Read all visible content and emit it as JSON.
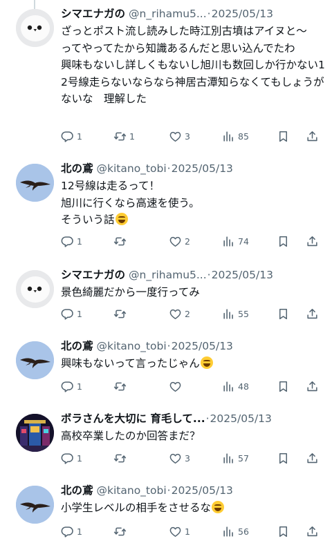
{
  "tweets": [
    {
      "avatar": "white-bird",
      "name": "シマエナガの",
      "handle": "@n_rihamu5...",
      "dot": "·",
      "time": "2025/05/13",
      "body": "ざっとポスト流し読みした時江別古墳はアイヌと〜　ってやってたから知識あるんだと思い込んでたわ\n興味もないし詳しくもないし旭川も数回しか行かない12号線走らないならなら神居古潭知らなくてもしょうがないな　理解した",
      "emoji": false,
      "replies": "1",
      "retweets": "1",
      "likes": "3",
      "views": "85"
    },
    {
      "avatar": "kite",
      "name": "北の鳶",
      "handle": "@kitano_tobi",
      "dot": "·",
      "time": "2025/05/13",
      "body": "12号線は走るって！\n旭川に行くなら高速を使う。\nそういう話",
      "emoji": true,
      "replies": "1",
      "retweets": "",
      "likes": "2",
      "views": "74"
    },
    {
      "avatar": "white-bird",
      "name": "シマエナガの",
      "handle": "@n_rihamu5...",
      "dot": "·",
      "time": "2025/05/13",
      "body": "景色綺麗だから一度行ってみ",
      "emoji": false,
      "replies": "1",
      "retweets": "",
      "likes": "2",
      "views": "55"
    },
    {
      "avatar": "kite",
      "name": "北の鳶",
      "handle": "@kitano_tobi",
      "dot": "·",
      "time": "2025/05/13",
      "body": "興味もないって言ったじゃん",
      "emoji": true,
      "replies": "1",
      "retweets": "",
      "likes": "",
      "views": "48"
    },
    {
      "avatar": "casino",
      "name": "ボラさんを大切に 育毛して...",
      "handle": "",
      "dot": "·",
      "time": "2025/05/13",
      "body": "高校卒業したのか回答まだ？",
      "emoji": false,
      "replies": "1",
      "retweets": "",
      "likes": "3",
      "views": "57"
    },
    {
      "avatar": "kite",
      "name": "北の鳶",
      "handle": "@kitano_tobi",
      "dot": "·",
      "time": "2025/05/13",
      "body": "小学生レベルの相手をさせるな",
      "emoji": true,
      "replies": "1",
      "retweets": "",
      "likes": "1",
      "views": "56"
    }
  ]
}
